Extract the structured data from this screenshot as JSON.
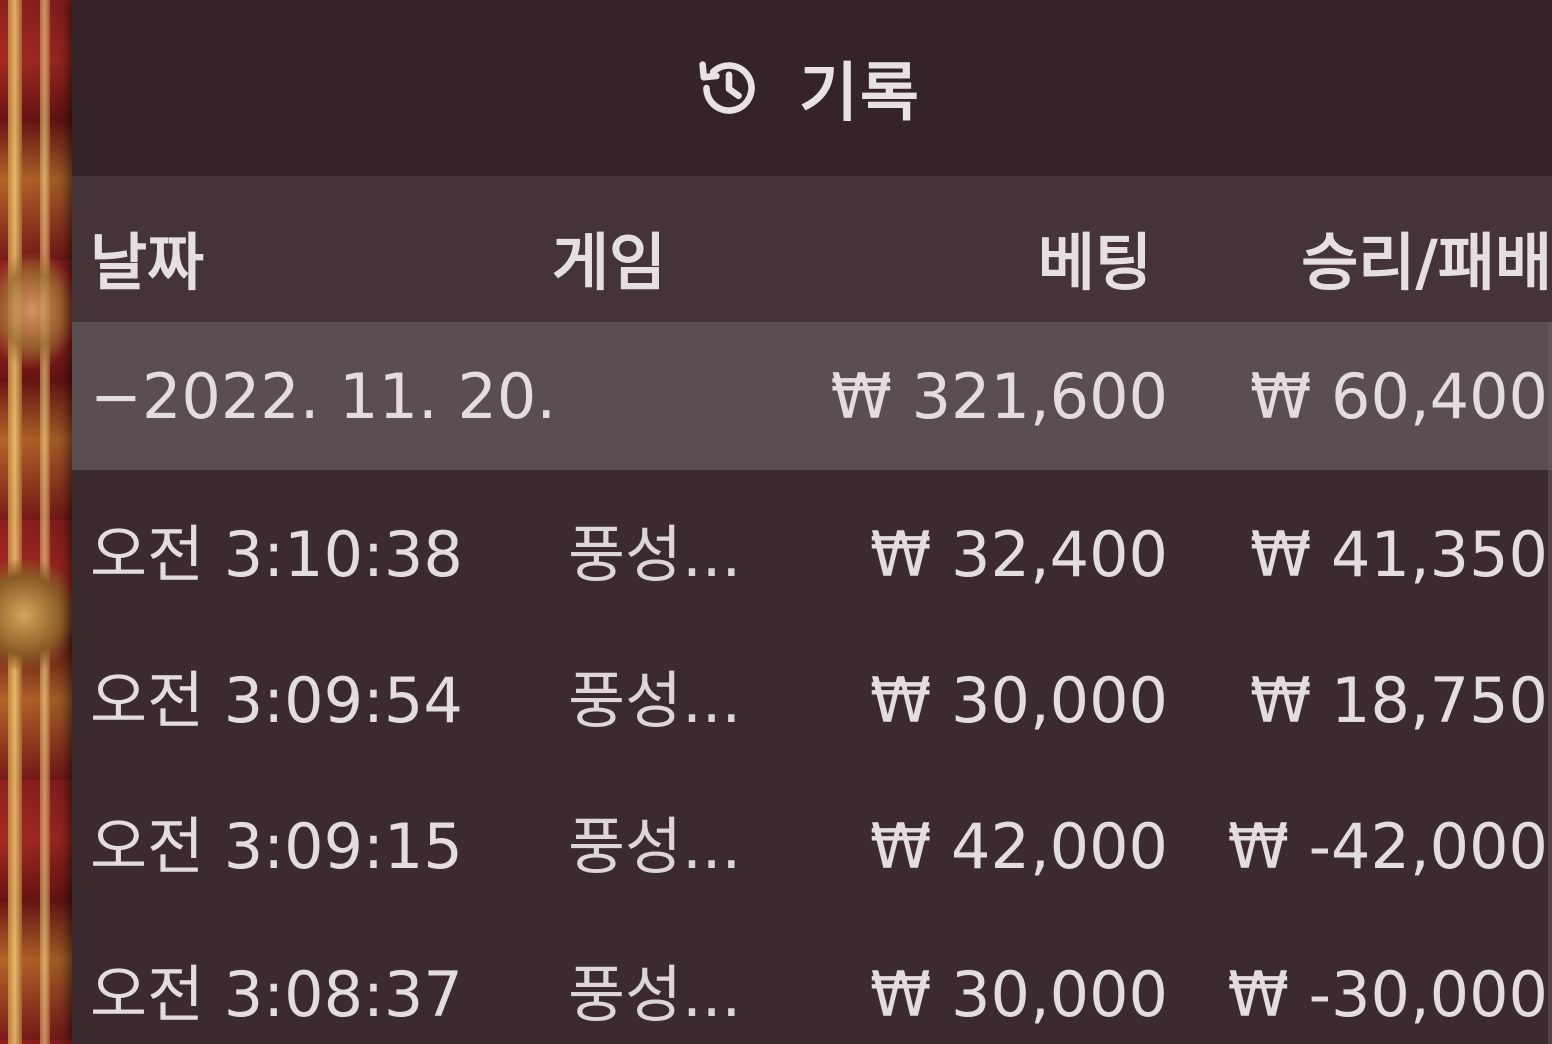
{
  "panel": {
    "title": "기록",
    "icon": "history-icon",
    "colors": {
      "panel_bg": "#3b2b2e",
      "header_bg": "#342427",
      "column_header_bg": "#453437",
      "summary_row_bg": "#5a4e50",
      "text": "#e4dddd"
    }
  },
  "columns": {
    "date": "날짜",
    "game": "게임",
    "bet": "베팅",
    "win_loss": "승리/패배"
  },
  "summary": {
    "date": "−2022. 11. 20.",
    "bet": "₩ 321,600",
    "win_loss": "₩ 60,400"
  },
  "rows": [
    {
      "time": "오전 3:10:38",
      "game": "풍성...",
      "bet": "₩ 32,400",
      "win_loss": "₩ 41,350"
    },
    {
      "time": "오전 3:09:54",
      "game": "풍성...",
      "bet": "₩ 30,000",
      "win_loss": "₩ 18,750"
    },
    {
      "time": "오전 3:09:15",
      "game": "풍성...",
      "bet": "₩ 42,000",
      "win_loss": "₩ -42,000"
    },
    {
      "time": "오전 3:08:37",
      "game": "풍성...",
      "bet": "₩ 30,000",
      "win_loss": "₩ -30,000"
    }
  ]
}
